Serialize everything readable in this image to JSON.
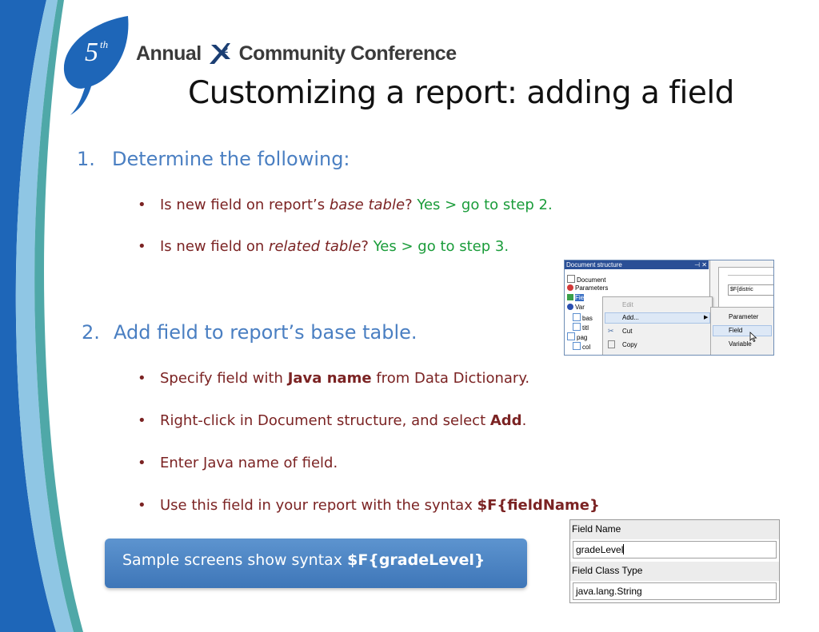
{
  "header": {
    "logo_superscript": "5th",
    "conference_name_before": "Annual",
    "conference_name_after": "Community Conference",
    "logo_mark": "X2"
  },
  "title": "Customizing a report: adding a field",
  "steps": [
    {
      "number": "1.",
      "heading": "Determine the following:",
      "bullets": [
        {
          "pre": "Is new field on report’s ",
          "italic": "base table",
          "post": "?",
          "green": "  Yes > go to step 2."
        },
        {
          "pre": "Is new field on ",
          "italic": "related table",
          "post": "? ",
          "green": "Yes > go to step 3."
        }
      ]
    },
    {
      "number": "2.",
      "heading": "Add field to report’s base table.",
      "bullets": [
        {
          "pre": "Specify field with ",
          "bold": "Java name",
          "post": " from Data Dictionary."
        },
        {
          "pre": "Right-click in Document structure, and select ",
          "bold": "Add",
          "post": "."
        },
        {
          "pre": "Enter Java name of field.",
          "bold": "",
          "post": ""
        },
        {
          "pre": "Use this field in your report with the syntax ",
          "bold": "$F{fieldName}",
          "post": ""
        }
      ]
    }
  ],
  "callout": {
    "pre": "Sample screens show syntax ",
    "bold": "$F{gradeLevel}"
  },
  "screenshot1": {
    "panel_title": "Document structure",
    "panel_controls": "⊣ ✕",
    "tree": [
      "Document",
      "Parameters",
      "Fie",
      "Var",
      "bas",
      "titl",
      "pag",
      "col"
    ],
    "context_menu": [
      "Edit",
      "Add...",
      "Cut",
      "Copy"
    ],
    "submenu": [
      "Parameter",
      "Field",
      "Variable"
    ],
    "canvas_text": "$F{distric"
  },
  "screenshot2": {
    "field_name_label": "Field Name",
    "field_name_value": "gradeLevel",
    "field_class_label": "Field Class Type",
    "field_class_value": "java.lang.String"
  },
  "colors": {
    "step_blue": "#4a7fc2",
    "bullet_red": "#7b2323",
    "green": "#1a9c3a",
    "swoosh_blue": "#1e66b8"
  }
}
